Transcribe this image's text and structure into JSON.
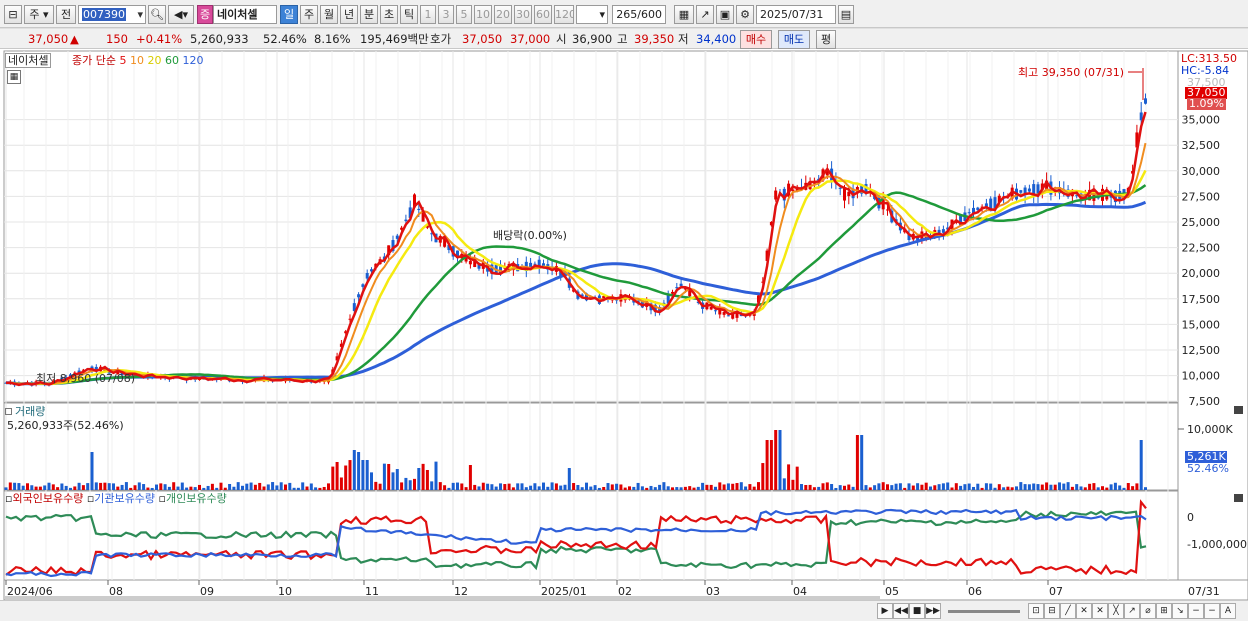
{
  "toolbar": {
    "period_left": "주",
    "prev_label": "전",
    "code_value": "007390",
    "stock_badge": "증",
    "stock_name": "네이처셀",
    "periods": [
      "일",
      "주",
      "월",
      "년",
      "분",
      "초",
      "틱"
    ],
    "selected_period": "일",
    "minute_values": [
      "1",
      "3",
      "5",
      "10",
      "20",
      "30",
      "60",
      "120"
    ],
    "count_value": "265",
    "count_total": "/600",
    "date_value": "2025/07/31"
  },
  "quote": {
    "price": "37,050",
    "arrow": "▲",
    "change": "150",
    "change_pct": "+0.41%",
    "volume": "5,260,933",
    "volume_ratio": "52.46%",
    "turnover": "8.16%",
    "amount": "195,469백만",
    "bid_label": "호가",
    "bid": "37,050",
    "ask": "37,000",
    "open_label": "시",
    "open": "36,900",
    "high_label": "고",
    "high": "39,350",
    "low_label": "저",
    "low": "34,400",
    "buy_button": "매수",
    "sell_button": "매도",
    "eval_button": "평"
  },
  "price_panel": {
    "name_tag": "네이처셀",
    "legend_prefix": "종가 단순",
    "ma_labels": [
      "5",
      "10",
      "20",
      "60",
      "120"
    ],
    "lc_label": "LC:313.50",
    "hc_label": "HC:-5.84",
    "faded_top_label": "37,500",
    "current_price_box": "37,050",
    "current_pct": "1.09%",
    "high_annotation": "최고 39,350 (07/31)",
    "low_annotation": "최저 8,960 (07/08)",
    "dividend_annotation": "배당락(0.00%)",
    "y_ticks": [
      "35,000",
      "32,500",
      "30,000",
      "27,500",
      "25,000",
      "22,500",
      "20,000",
      "17,500",
      "15,000",
      "12,500",
      "10,000",
      "7,500"
    ]
  },
  "volume_panel": {
    "title": "거래량",
    "value": "5,260,933주(52.46%)",
    "y_tick": "10,000K",
    "current_box": "5,261K",
    "current_pct": "52.46%"
  },
  "holding_panel": {
    "legend": [
      "외국인보유수량",
      "기관보유수량",
      "개인보유수량"
    ],
    "y_ticks": [
      "0",
      "-1,000,000"
    ]
  },
  "x_axis": {
    "labels": [
      "2024/06",
      "08",
      "09",
      "10",
      "11",
      "12",
      "2025/01",
      "02",
      "03",
      "04",
      "05",
      "06",
      "07"
    ],
    "right_label": "07/31"
  },
  "colors": {
    "candle_up": "#e00000",
    "candle_down": "#1a5fd0",
    "ma5": "#e01010",
    "ma10": "#f08c1e",
    "ma20": "#f5ea10",
    "ma60": "#1f9a3a",
    "ma120": "#2e5fd8",
    "foreign": "#2e5fd8",
    "institution": "#e01010",
    "individual": "#2e8b57"
  }
}
